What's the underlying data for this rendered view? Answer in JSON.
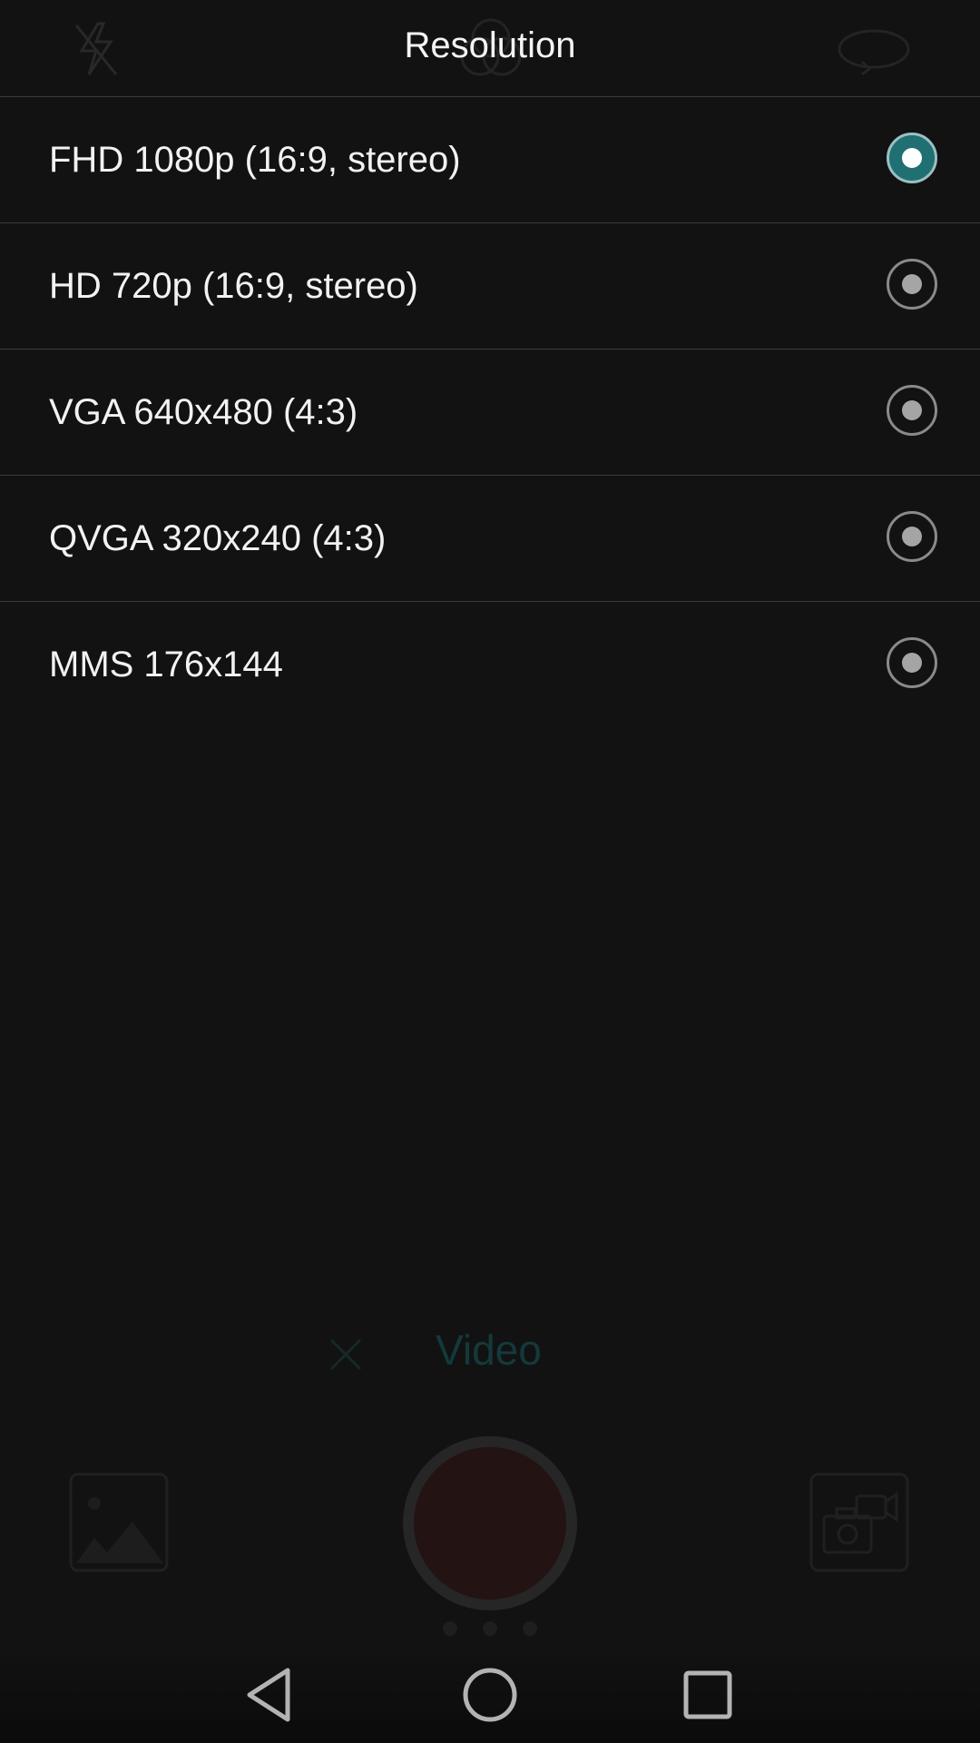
{
  "header": {
    "title": "Resolution"
  },
  "resolution_options": [
    {
      "label": "FHD 1080p (16:9, stereo)",
      "selected": true
    },
    {
      "label": "HD 720p (16:9, stereo)",
      "selected": false
    },
    {
      "label": "VGA 640x480 (4:3)",
      "selected": false
    },
    {
      "label": "QVGA 320x240 (4:3)",
      "selected": false
    },
    {
      "label": "MMS 176x144",
      "selected": false
    }
  ],
  "camera": {
    "mode_label": "Video",
    "mode_page_count": 3
  },
  "icons": {
    "flash": "flash-off-icon",
    "filter": "filter-icon",
    "switch": "switch-camera-icon",
    "gallery": "gallery-icon",
    "camera_switch": "camera-video-switch-icon",
    "close": "close-icon",
    "nav_back": "back-icon",
    "nav_home": "home-icon",
    "nav_recents": "recents-icon"
  },
  "colors": {
    "background": "#121212",
    "accent": "#1f6f73",
    "divider": "#3a3a3a",
    "text": "#f2f2f2"
  }
}
